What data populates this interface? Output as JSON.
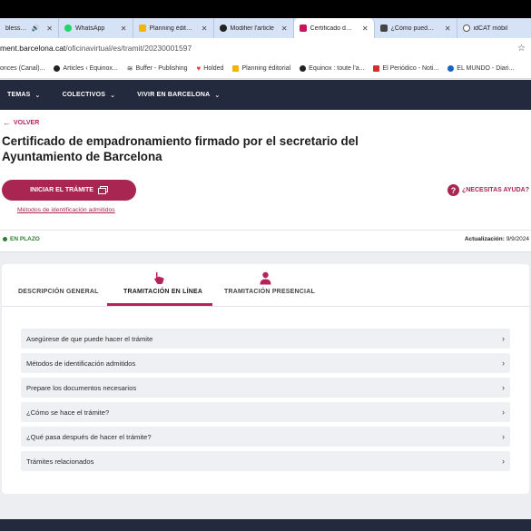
{
  "browser": {
    "tabs": [
      {
        "label": "blessed ·",
        "favicon_color": "#7d7d7d",
        "active": false,
        "extra": "🔊"
      },
      {
        "label": "WhatsApp",
        "favicon_color": "#25d366",
        "active": false
      },
      {
        "label": "Planning éditorial",
        "favicon_color": "#f4b400",
        "active": false
      },
      {
        "label": "Modifier l'article",
        "favicon_color": "#222222",
        "active": false
      },
      {
        "label": "Certificado de em",
        "favicon_color": "#c2185b",
        "active": true
      },
      {
        "label": "¿Cómo puedo de",
        "favicon_color": "#444444",
        "active": false
      },
      {
        "label": "idCAT mòbil",
        "favicon_color": "#555555",
        "active": false
      }
    ],
    "url_host": "ment.barcelona.cat",
    "url_path": "/oficinavirtual/es/tramit/20230001597",
    "bookmarks": [
      {
        "label": "onces (Canal)...",
        "color": "#999999"
      },
      {
        "label": "Articles ‹ Equinox...",
        "color": "#222222"
      },
      {
        "label": "Buffer - Publishing",
        "color": "#333333"
      },
      {
        "label": "Holded",
        "color": "#e53935"
      },
      {
        "label": "Planning éditorial",
        "color": "#f4b400"
      },
      {
        "label": "Equinox : toute l'a...",
        "color": "#222222"
      },
      {
        "label": "El Periódico - Noti...",
        "color": "#d32f2f"
      },
      {
        "label": "EL MUNDO - Diari...",
        "color": "#1565c0"
      }
    ]
  },
  "site_nav": {
    "items": [
      "TEMAS",
      "COLECTIVOS",
      "VIVIR EN BARCELONA"
    ]
  },
  "header": {
    "back_label": "VOLVER",
    "title": "Certificado de empadronamiento firmado por el secretario del Ayuntamiento de Barcelona",
    "cta_label": "INICIAR EL TRÁMITE",
    "id_link": "Métodos de identificación admitidos",
    "help_label": "¿NECESITAS AYUDA?",
    "status_label": "EN PLAZO",
    "updated_label": "Actualización:",
    "updated_date": "9/9/2024",
    "accent_color": "#a92552",
    "status_color": "#2e7d32"
  },
  "procedure_tabs": [
    {
      "label": "DESCRIPCIÓN GENERAL",
      "active": false
    },
    {
      "label": "TRAMITACIÓN EN LÍNEA",
      "active": true,
      "icon": "hand-pointer-icon"
    },
    {
      "label": "TRAMITACIÓN PRESENCIAL",
      "active": false,
      "icon": "person-icon"
    }
  ],
  "accordion": [
    "Asegúrese de que puede hacer el trámite",
    "Métodos de identificación admitidos",
    "Prepare los documentos necesarios",
    "¿Cómo se hace el trámite?",
    "¿Qué pasa después de hacer el trámite?",
    "Trámites relacionados"
  ]
}
